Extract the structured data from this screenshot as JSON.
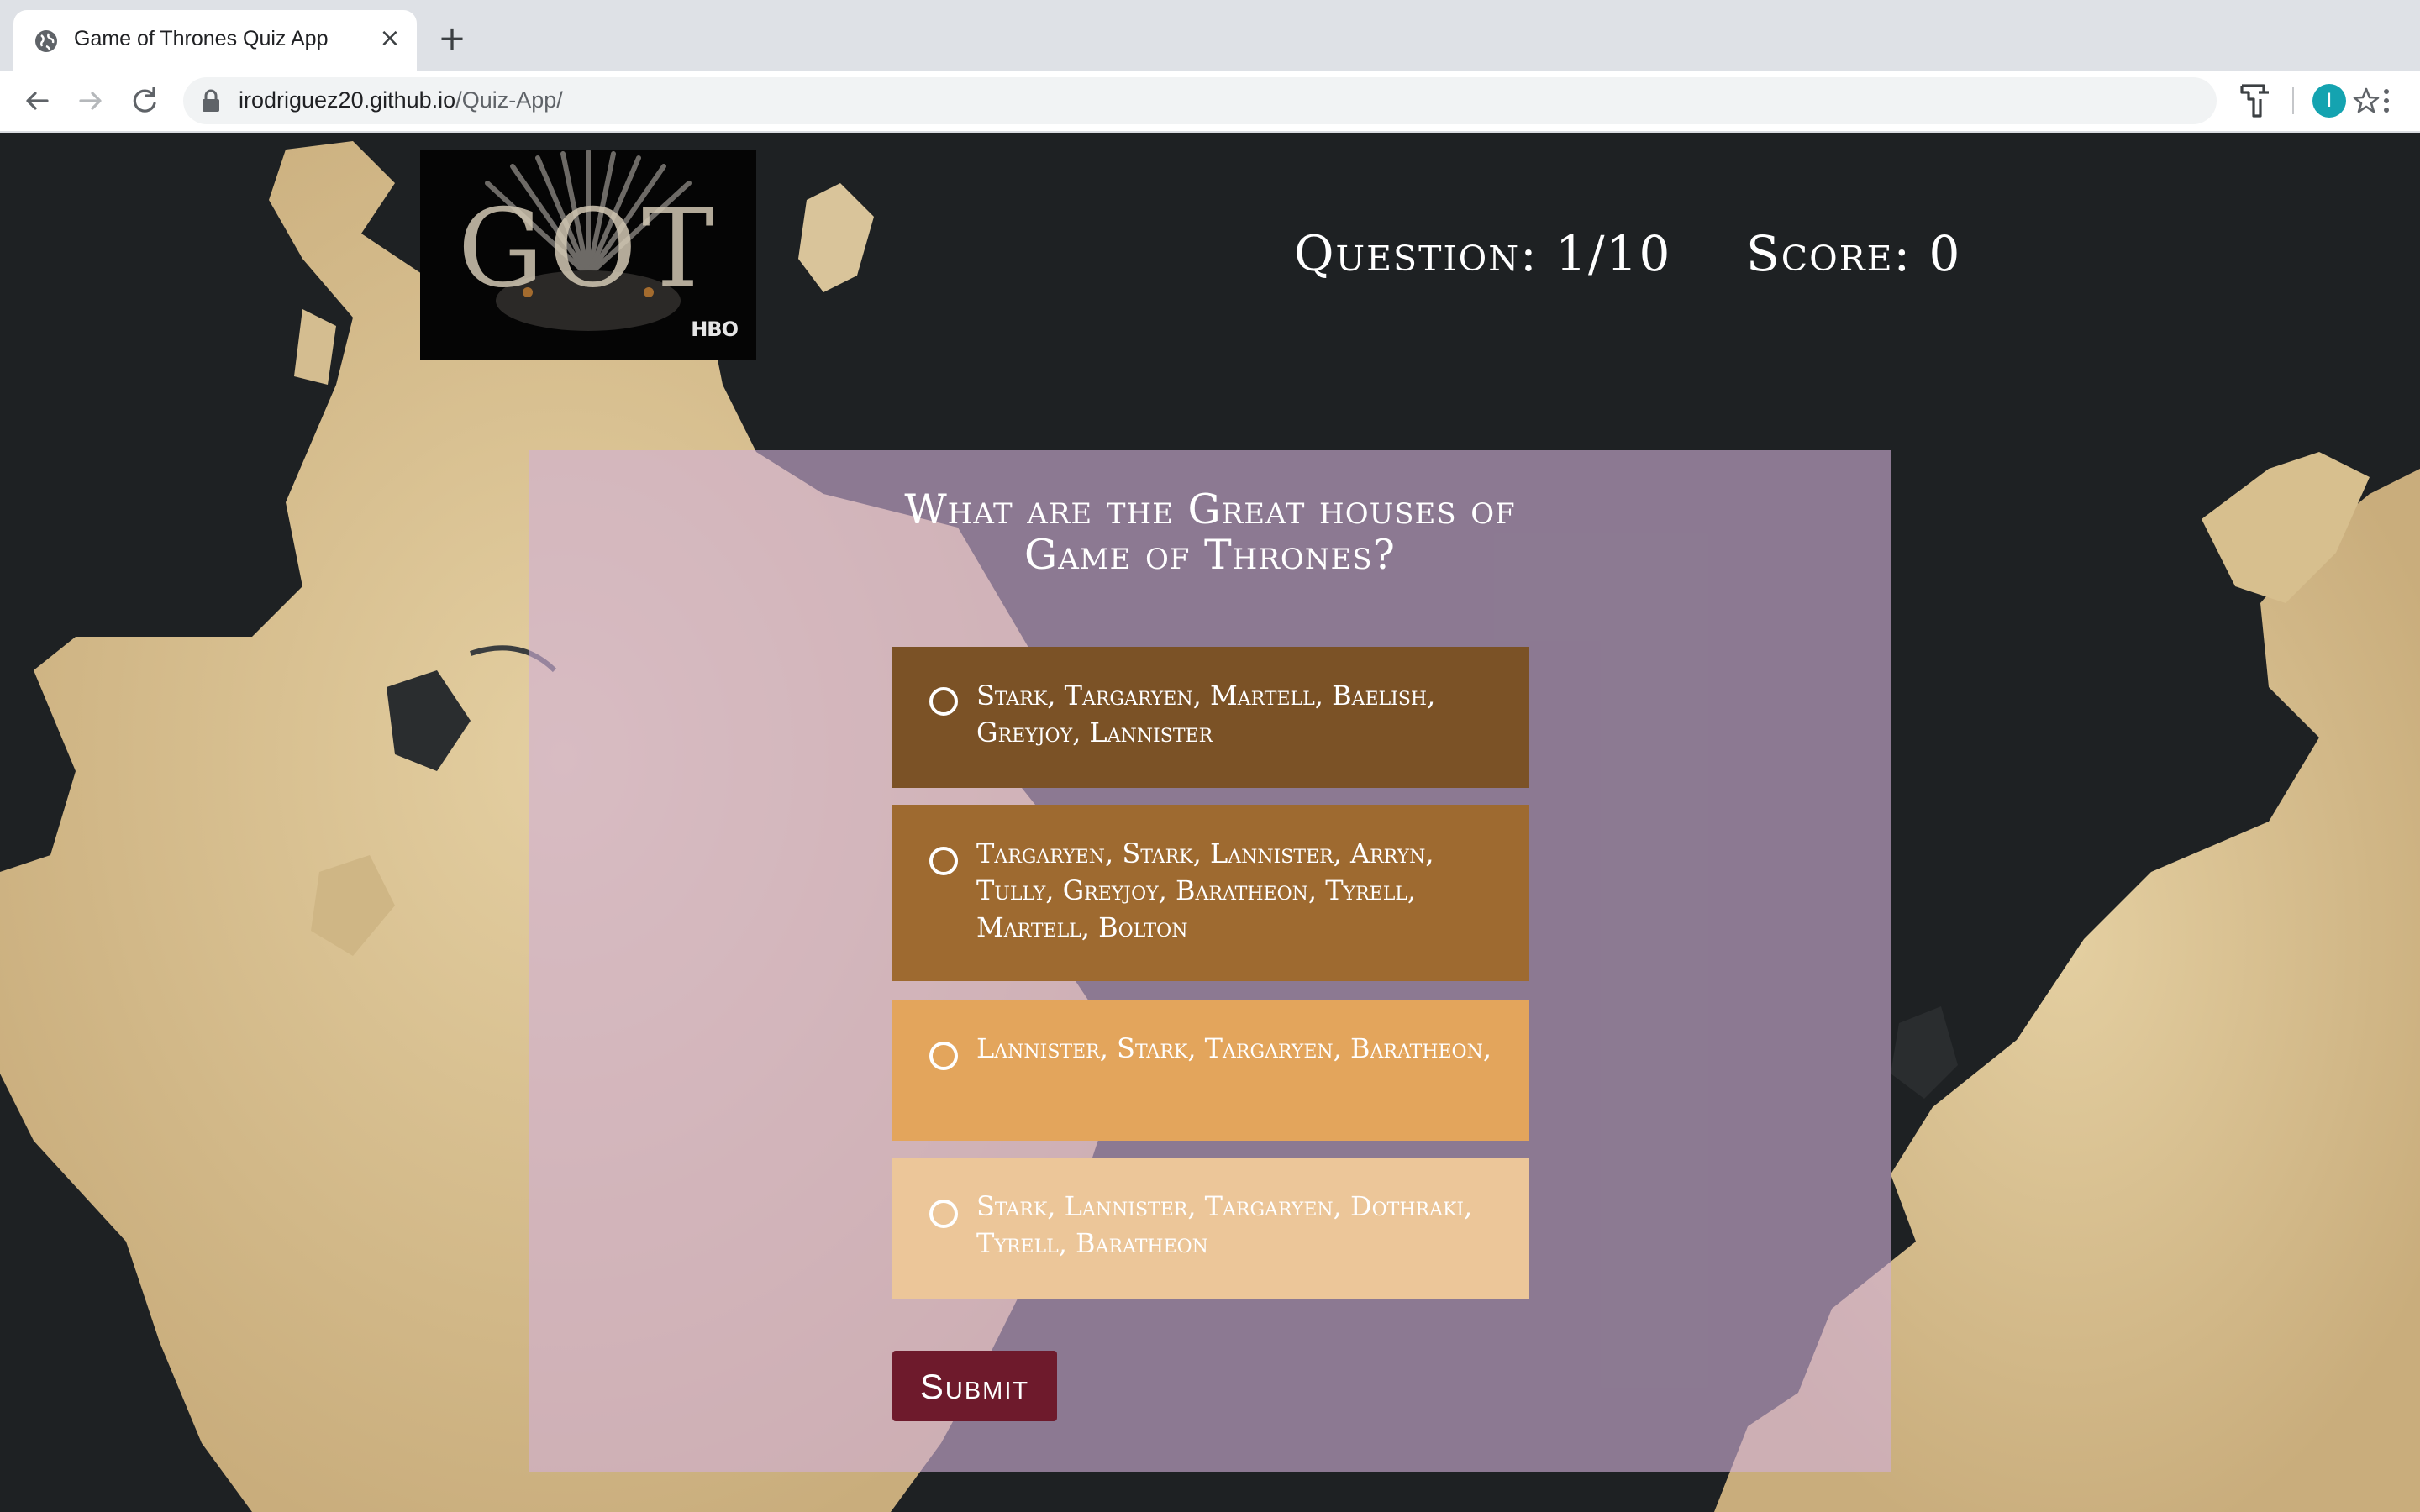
{
  "browser": {
    "tab_title": "Game of Thrones Quiz App",
    "url_host": "irodriguez20.github.io",
    "url_path": "/Quiz-App/",
    "profile_initial": "I"
  },
  "header": {
    "logo_text": "GOT",
    "logo_network": "HBO",
    "question_counter": "Question: 1/10",
    "score": "Score: 0"
  },
  "quiz": {
    "question": "What are the Great houses of Game of Thrones?",
    "options": [
      {
        "label": "Stark, Targaryen, Martell, Baelish, Greyjoy, Lannister",
        "color": "#7b5226"
      },
      {
        "label": "Targaryen, Stark, Lannister, Arryn, Tully, Greyjoy, Baratheon, Tyrell, Martell, Bolton",
        "color": "#9e6a30"
      },
      {
        "label": "Lannister, Stark, Targaryen, Baratheon,",
        "color": "#e3a55c"
      },
      {
        "label": "Stark, Lannister, Targaryen, Dothraki, Tyrell, Baratheon",
        "color": "#ecc699"
      }
    ],
    "submit_label": "Submit"
  }
}
